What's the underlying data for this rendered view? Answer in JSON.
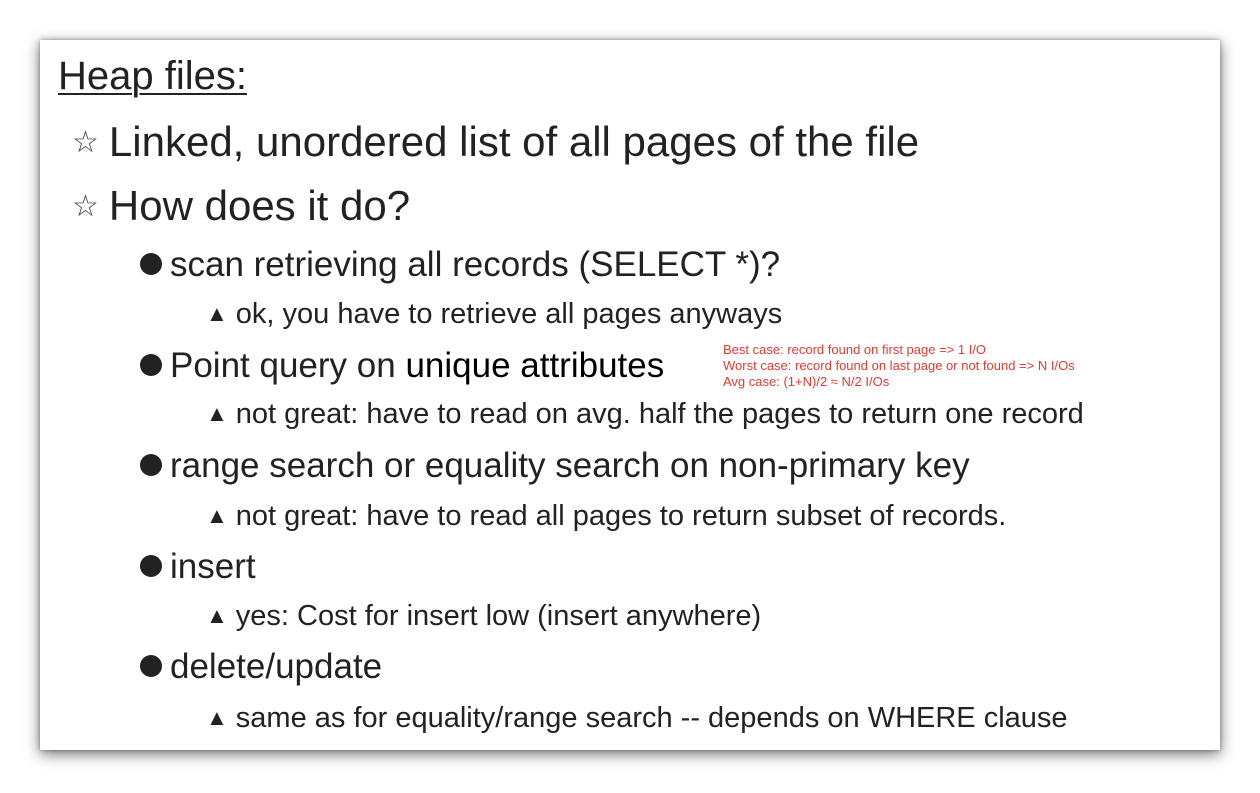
{
  "slide": {
    "title": "Heap files:",
    "bullets": [
      "Linked, unordered list of all pages of the file",
      "How does it do?"
    ],
    "sub": [
      {
        "pre": "scan retrieving all records (SELECT *)?",
        "emph": "",
        "detail": "ok, you have to retrieve all pages anyways"
      },
      {
        "pre": "Point query on ",
        "emph": "unique attributes",
        "detail": "not great: have to read on avg. half the pages to return one record"
      },
      {
        "pre": "range search or equality search on non-primary key",
        "emph": "",
        "detail": "not great: have to read all pages to return subset of records."
      },
      {
        "pre": "insert",
        "emph": "",
        "detail": "yes: Cost for insert low (insert anywhere)"
      },
      {
        "pre": "delete/update",
        "emph": "",
        "detail": "same as for equality/range search -- depends on WHERE clause"
      }
    ],
    "annotation": [
      "Best case: record found on first page => 1 I/O",
      "Worst case: record found on last page or not found => N I/Os",
      "Avg case: (1+N)/2 ≈ N/2 I/Os"
    ]
  },
  "icons": {
    "level1": "star-outline-icon",
    "level2": "filled-circle-icon",
    "level3": "triangle-up-icon"
  },
  "colors": {
    "text": "#222222",
    "annotation": "#e23a2e"
  }
}
